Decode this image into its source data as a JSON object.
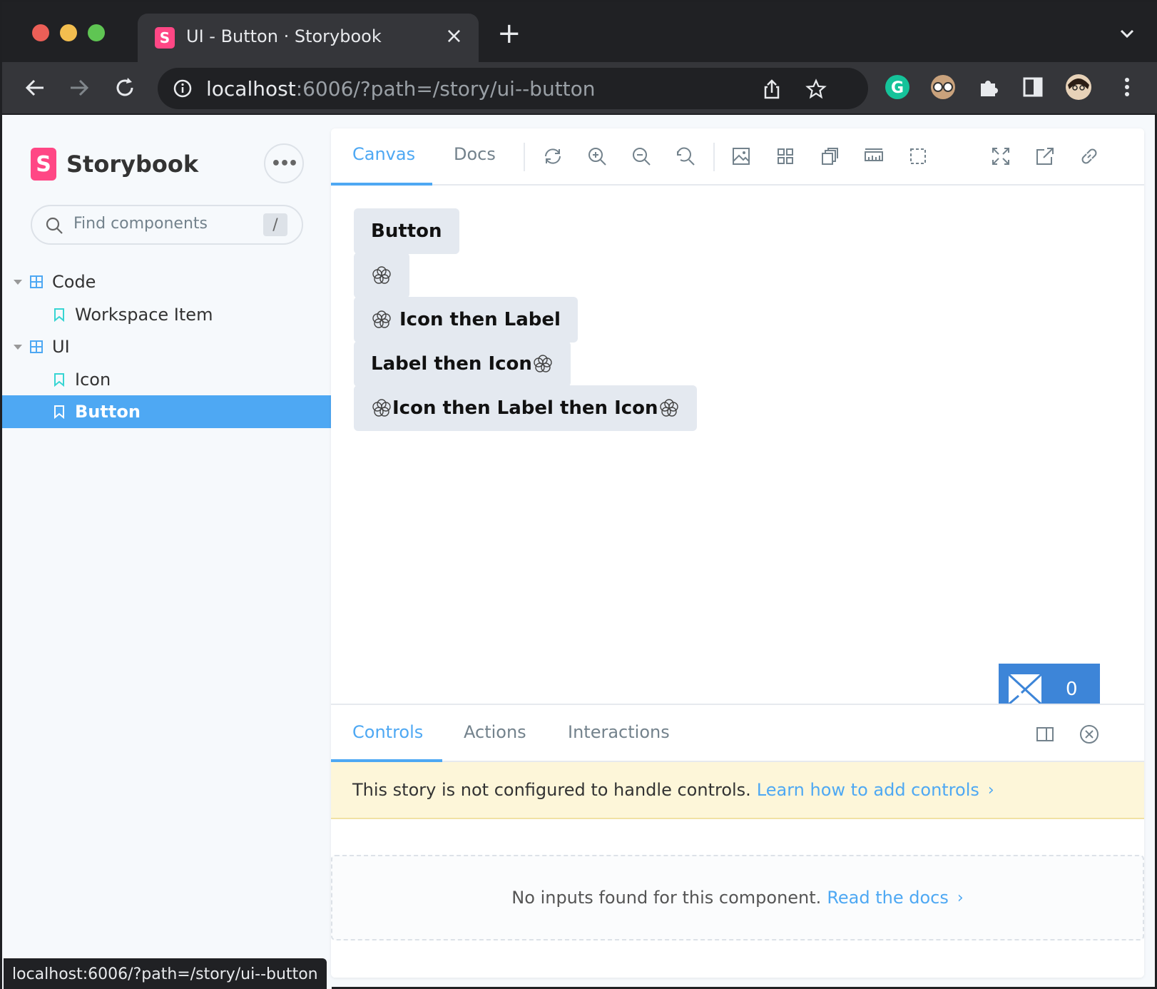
{
  "browser": {
    "tab_title": "UI - Button · Storybook",
    "url_host": "localhost",
    "url_rest": ":6006/?path=/story/ui--button",
    "status_url": "localhost:6006/?path=/story/ui--button"
  },
  "sidebar": {
    "brand": "Storybook",
    "search_placeholder": "Find components",
    "search_shortcut": "/",
    "tree": [
      {
        "label": "Code",
        "type": "component"
      },
      {
        "label": "Workspace Item",
        "type": "story"
      },
      {
        "label": "UI",
        "type": "component"
      },
      {
        "label": "Icon",
        "type": "story"
      },
      {
        "label": "Button",
        "type": "story",
        "selected": true
      }
    ]
  },
  "toolbar": {
    "tabs": [
      "Canvas",
      "Docs"
    ],
    "active_tab": "Canvas"
  },
  "canvas": {
    "buttons": [
      {
        "label": "Button",
        "icon_before": false,
        "icon_after": false
      },
      {
        "label": "",
        "icon_before": true,
        "icon_after": false
      },
      {
        "label": "Icon then Label",
        "icon_before": true,
        "icon_after": false
      },
      {
        "label": "Label then Icon",
        "icon_before": false,
        "icon_after": true
      },
      {
        "label": "Icon then Label then Icon",
        "icon_before": true,
        "icon_after": true
      }
    ],
    "badge_count": "0"
  },
  "addons": {
    "tabs": [
      "Controls",
      "Actions",
      "Interactions"
    ],
    "active_tab": "Controls",
    "notice_text": "This story is not configured to handle controls.",
    "notice_link": "Learn how to add controls",
    "empty_text": "No inputs found for this component.",
    "empty_link": "Read the docs"
  },
  "colors": {
    "accent": "#4ea8f3",
    "brand": "#ff4785",
    "selected_bg": "#4ea8f3",
    "notice_bg": "#fdf6d9",
    "badge_bg": "#3d85d8"
  }
}
